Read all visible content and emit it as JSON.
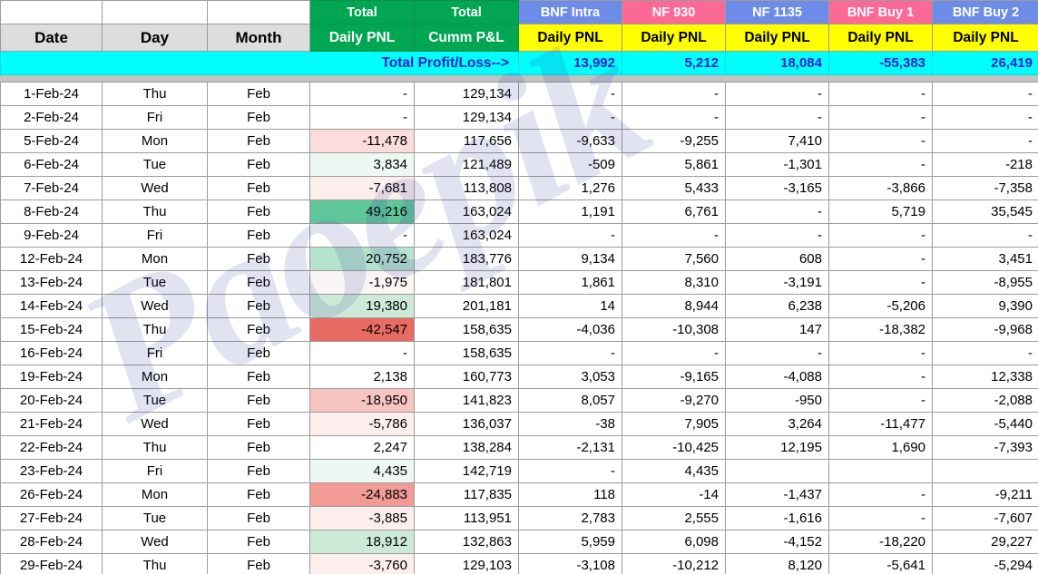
{
  "header": {
    "group_labels": [
      "",
      "",
      "",
      "Total",
      "Total",
      "BNF Intra",
      "NF 930",
      "NF 1135",
      "BNF Buy 1",
      "BNF Buy 2"
    ],
    "column_labels": [
      "Date",
      "Day",
      "Month",
      "Daily PNL",
      "Cumm P&L",
      "Daily PNL",
      "Daily PNL",
      "Daily PNL",
      "Daily PNL",
      "Daily PNL"
    ],
    "group_colors": [
      "#ffffff",
      "#ffffff",
      "#ffffff",
      "#00a651",
      "#00a651",
      "#6d8ce8",
      "#fb6a96",
      "#6d8ce8",
      "#fb6a96",
      "#6d8ce8"
    ]
  },
  "totals": {
    "label": "Total Profit/Loss-->",
    "values": [
      "13,992",
      "5,212",
      "18,084",
      "-55,383",
      "26,419"
    ],
    "band_color": "#00ffff",
    "text_color": "#2222cc"
  },
  "watermark": {
    "text": "Paoepik"
  },
  "rows": [
    {
      "date": "1-Feb-24",
      "day": "Thu",
      "month": "Feb",
      "daily": "-",
      "fill": "none",
      "cumm": "129,134",
      "bnf_intra": "-",
      "nf930": "-",
      "nf1135": "-",
      "bnf_buy1": "-",
      "bnf_buy2": "-"
    },
    {
      "date": "2-Feb-24",
      "day": "Fri",
      "month": "Feb",
      "daily": "-",
      "fill": "none",
      "cumm": "129,134",
      "bnf_intra": "-",
      "nf930": "-",
      "nf1135": "-",
      "bnf_buy1": "-",
      "bnf_buy2": "-"
    },
    {
      "date": "5-Feb-24",
      "day": "Mon",
      "month": "Feb",
      "daily": "-11,478",
      "fill": "hs-r2",
      "cumm": "117,656",
      "bnf_intra": "-9,633",
      "nf930": "-9,255",
      "nf1135": "7,410",
      "bnf_buy1": "-",
      "bnf_buy2": "-"
    },
    {
      "date": "6-Feb-24",
      "day": "Tue",
      "month": "Feb",
      "daily": "3,834",
      "fill": "hs-g1",
      "cumm": "121,489",
      "bnf_intra": "-509",
      "nf930": "5,861",
      "nf1135": "-1,301",
      "bnf_buy1": "-",
      "bnf_buy2": "-218"
    },
    {
      "date": "7-Feb-24",
      "day": "Wed",
      "month": "Feb",
      "daily": "-7,681",
      "fill": "hs-r1",
      "cumm": "113,808",
      "bnf_intra": "1,276",
      "nf930": "5,433",
      "nf1135": "-3,165",
      "bnf_buy1": "-3,866",
      "bnf_buy2": "-7,358"
    },
    {
      "date": "8-Feb-24",
      "day": "Thu",
      "month": "Feb",
      "daily": "49,216",
      "fill": "hs-g4",
      "cumm": "163,024",
      "bnf_intra": "1,191",
      "nf930": "6,761",
      "nf1135": "-",
      "bnf_buy1": "5,719",
      "bnf_buy2": "35,545"
    },
    {
      "date": "9-Feb-24",
      "day": "Fri",
      "month": "Feb",
      "daily": "-",
      "fill": "none",
      "cumm": "163,024",
      "bnf_intra": "-",
      "nf930": "-",
      "nf1135": "-",
      "bnf_buy1": "-",
      "bnf_buy2": "-"
    },
    {
      "date": "12-Feb-24",
      "day": "Mon",
      "month": "Feb",
      "daily": "20,752",
      "fill": "hs-g3",
      "cumm": "183,776",
      "bnf_intra": "9,134",
      "nf930": "7,560",
      "nf1135": "608",
      "bnf_buy1": "-",
      "bnf_buy2": "3,451"
    },
    {
      "date": "13-Feb-24",
      "day": "Tue",
      "month": "Feb",
      "daily": "-1,975",
      "fill": "hs-n",
      "cumm": "181,801",
      "bnf_intra": "1,861",
      "nf930": "8,310",
      "nf1135": "-3,191",
      "bnf_buy1": "-",
      "bnf_buy2": "-8,955"
    },
    {
      "date": "14-Feb-24",
      "day": "Wed",
      "month": "Feb",
      "daily": "19,380",
      "fill": "hs-g2",
      "cumm": "201,181",
      "bnf_intra": "14",
      "nf930": "8,944",
      "nf1135": "6,238",
      "bnf_buy1": "-5,206",
      "bnf_buy2": "9,390"
    },
    {
      "date": "15-Feb-24",
      "day": "Thu",
      "month": "Feb",
      "daily": "-42,547",
      "fill": "hs-r5",
      "cumm": "158,635",
      "bnf_intra": "-4,036",
      "nf930": "-10,308",
      "nf1135": "147",
      "bnf_buy1": "-18,382",
      "bnf_buy2": "-9,968"
    },
    {
      "date": "16-Feb-24",
      "day": "Fri",
      "month": "Feb",
      "daily": "-",
      "fill": "none",
      "cumm": "158,635",
      "bnf_intra": "-",
      "nf930": "-",
      "nf1135": "-",
      "bnf_buy1": "-",
      "bnf_buy2": "-"
    },
    {
      "date": "19-Feb-24",
      "day": "Mon",
      "month": "Feb",
      "daily": "2,138",
      "fill": "none",
      "cumm": "160,773",
      "bnf_intra": "3,053",
      "nf930": "-9,165",
      "nf1135": "-4,088",
      "bnf_buy1": "-",
      "bnf_buy2": "12,338"
    },
    {
      "date": "20-Feb-24",
      "day": "Tue",
      "month": "Feb",
      "daily": "-18,950",
      "fill": "hs-r3",
      "cumm": "141,823",
      "bnf_intra": "8,057",
      "nf930": "-9,270",
      "nf1135": "-950",
      "bnf_buy1": "-",
      "bnf_buy2": "-2,088"
    },
    {
      "date": "21-Feb-24",
      "day": "Wed",
      "month": "Feb",
      "daily": "-5,786",
      "fill": "hs-r1",
      "cumm": "136,037",
      "bnf_intra": "-38",
      "nf930": "7,905",
      "nf1135": "3,264",
      "bnf_buy1": "-11,477",
      "bnf_buy2": "-5,440"
    },
    {
      "date": "22-Feb-24",
      "day": "Thu",
      "month": "Feb",
      "daily": "2,247",
      "fill": "none",
      "cumm": "138,284",
      "bnf_intra": "-2,131",
      "nf930": "-10,425",
      "nf1135": "12,195",
      "bnf_buy1": "1,690",
      "bnf_buy2": "-7,393"
    },
    {
      "date": "23-Feb-24",
      "day": "Fri",
      "month": "Feb",
      "daily": "4,435",
      "fill": "hs-g1",
      "cumm": "142,719",
      "bnf_intra": "-",
      "nf930": "4,435",
      "nf1135": "",
      "bnf_buy1": "",
      "bnf_buy2": ""
    },
    {
      "date": "26-Feb-24",
      "day": "Mon",
      "month": "Feb",
      "daily": "-24,883",
      "fill": "hs-r4",
      "cumm": "117,835",
      "bnf_intra": "118",
      "nf930": "-14",
      "nf1135": "-1,437",
      "bnf_buy1": "-",
      "bnf_buy2": "-9,211"
    },
    {
      "date": "27-Feb-24",
      "day": "Tue",
      "month": "Feb",
      "daily": "-3,885",
      "fill": "hs-r1",
      "cumm": "113,951",
      "bnf_intra": "2,783",
      "nf930": "2,555",
      "nf1135": "-1,616",
      "bnf_buy1": "-",
      "bnf_buy2": "-7,607"
    },
    {
      "date": "28-Feb-24",
      "day": "Wed",
      "month": "Feb",
      "daily": "18,912",
      "fill": "hs-g2",
      "cumm": "132,863",
      "bnf_intra": "5,959",
      "nf930": "6,098",
      "nf1135": "-4,152",
      "bnf_buy1": "-18,220",
      "bnf_buy2": "29,227"
    },
    {
      "date": "29-Feb-24",
      "day": "Thu",
      "month": "Feb",
      "daily": "-3,760",
      "fill": "hs-r1",
      "cumm": "129,103",
      "bnf_intra": "-3,108",
      "nf930": "-10,212",
      "nf1135": "8,120",
      "bnf_buy1": "-5,641",
      "bnf_buy2": "-5,294"
    }
  ]
}
